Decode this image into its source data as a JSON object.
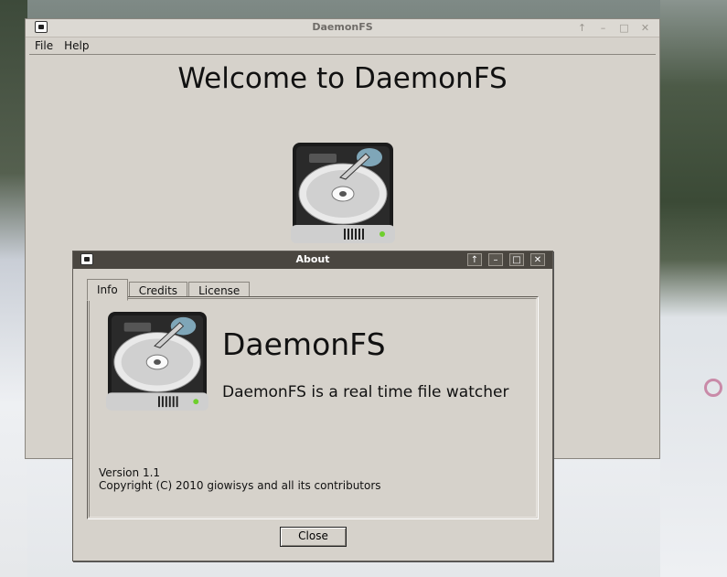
{
  "main_window": {
    "title": "DaemonFS",
    "menu": [
      "File",
      "Help"
    ],
    "welcome_text": "Welcome to DaemonFS",
    "titlebar_buttons": [
      "up-icon",
      "minimize-icon",
      "maximize-icon",
      "close-icon"
    ]
  },
  "about_dialog": {
    "title": "About",
    "tabs": [
      "Info",
      "Credits",
      "License"
    ],
    "active_tab": "Info",
    "app_name": "DaemonFS",
    "description": "DaemonFS is a real time file watcher",
    "version": "Version 1.1",
    "copyright": "Copyright (C) 2010 giowisys and all its contributors",
    "close_label": "Close",
    "titlebar_buttons": [
      "up-icon",
      "minimize-icon",
      "maximize-icon",
      "close-icon"
    ]
  }
}
